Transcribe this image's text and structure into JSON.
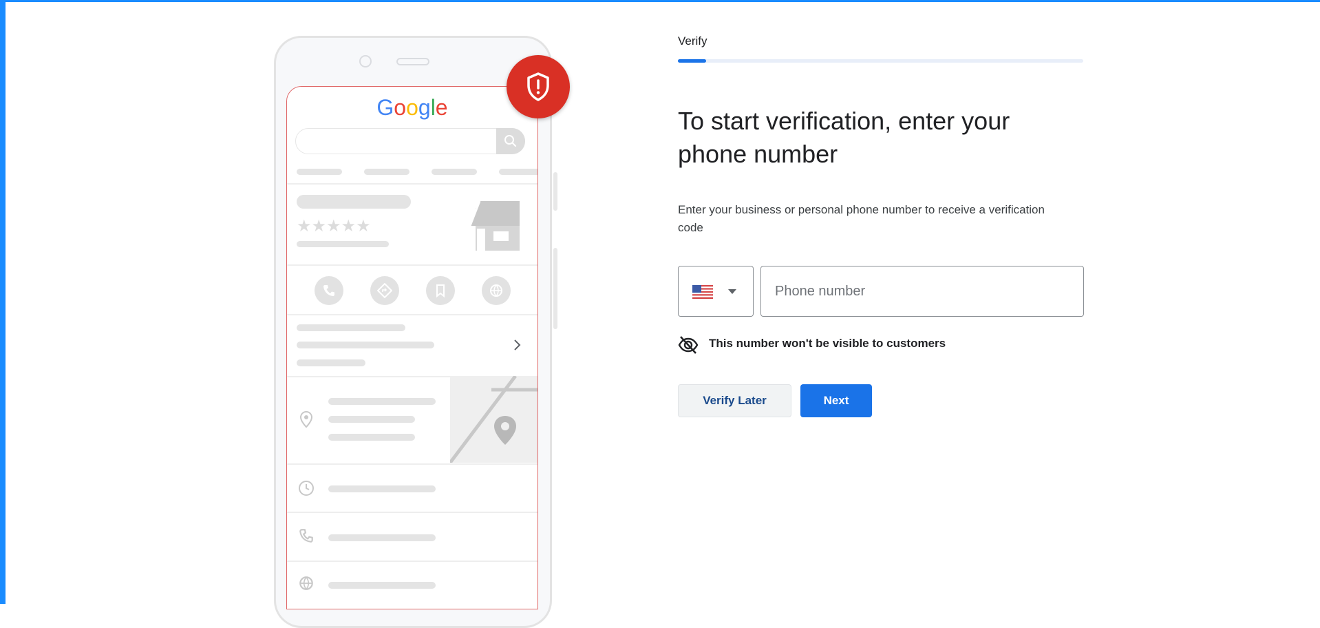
{
  "colors": {
    "accent": "#1a73e8",
    "frame": "#1a8cff",
    "alert_red": "#d93025"
  },
  "illustration": {
    "logo_letters": [
      {
        "ch": "G",
        "color": "#4285f4"
      },
      {
        "ch": "o",
        "color": "#ea4335"
      },
      {
        "ch": "o",
        "color": "#fbbc05"
      },
      {
        "ch": "g",
        "color": "#4285f4"
      },
      {
        "ch": "l",
        "color": "#34a853"
      },
      {
        "ch": "e",
        "color": "#ea4335"
      }
    ],
    "stars": "★★★★★",
    "badge_icon": "shield-alert-icon"
  },
  "stepper": {
    "label": "Verify",
    "progress": 0.07
  },
  "form": {
    "title": "To start verification, enter your phone number",
    "description": "Enter your business or personal phone number to receive a verification code",
    "country": {
      "selected_icon": "us-flag-icon",
      "caret_icon": "caret-down-icon"
    },
    "phone_placeholder": "Phone number",
    "phone_value": "",
    "privacy_icon": "eye-off-icon",
    "privacy_note": "This number won't be visible to customers",
    "verify_later_label": "Verify Later",
    "next_label": "Next"
  }
}
